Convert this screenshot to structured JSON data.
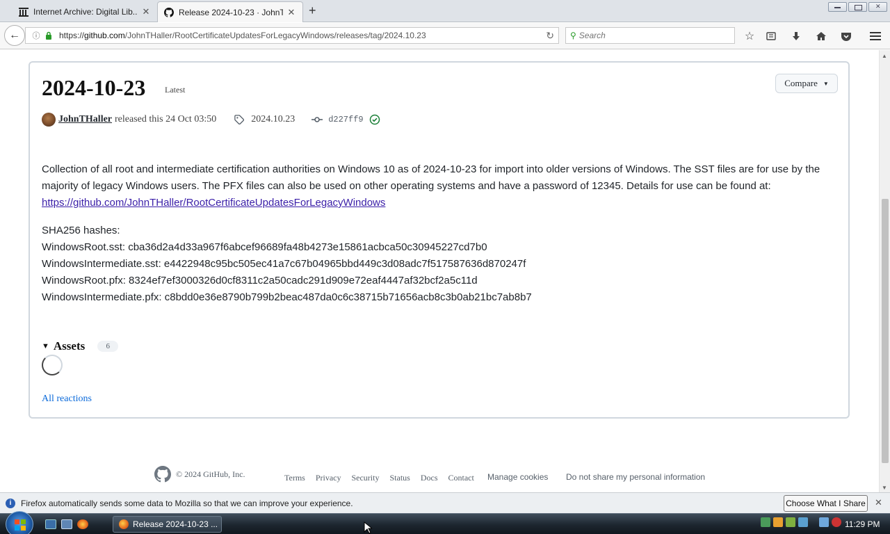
{
  "browser": {
    "tabs": [
      {
        "title": "Internet Archive: Digital Lib..."
      },
      {
        "title": "Release 2024-10-23 · JohnT..."
      }
    ],
    "url": {
      "prefix": "https://",
      "host": "github.com",
      "path": "/JohnTHaller/RootCertificateUpdatesForLegacyWindows/releases/tag/2024.10.23"
    },
    "search_placeholder": "Search"
  },
  "release": {
    "title": "2024-10-23",
    "badge": "Latest",
    "compare_label": "Compare",
    "author": "JohnTHaller",
    "released_text": "released this 24 Oct 03:50",
    "tag": "2024.10.23",
    "commit": "d227ff9",
    "description": "Collection of all root and intermediate certification authorities on Windows 10 as of 2024-10-23 for import into older versions of Windows. The SST files are for use by the majority of legacy Windows users. The PFX files can also be used on other operating systems and have a password of 12345. Details for use can be found at:",
    "link": "https://github.com/JohnTHaller/RootCertificateUpdatesForLegacyWindows",
    "hashes_heading": "SHA256 hashes:",
    "hashes": [
      "WindowsRoot.sst: cba36d2a4d33a967f6abcef96689fa48b4273e15861acbca50c30945227cd7b0",
      "WindowsIntermediate.sst: e4422948c95bc505ec41a7c67b04965bbd449c3d08adc7f517587636d870247f",
      "WindowsRoot.pfx: 8324ef7ef3000326d0cf8311c2a50cadc291d909e72eaf4447af32bcf2a5c11d",
      "WindowsIntermediate.pfx: c8bdd0e36e8790b799b2beac487da0c6c38715b71656acb8c3b0ab21bc7ab8b7"
    ],
    "assets_label": "Assets",
    "assets_count": "6",
    "reactions_label": "All reactions"
  },
  "footer": {
    "copyright": "© 2024 GitHub, Inc.",
    "links": [
      "Terms",
      "Privacy",
      "Security",
      "Status",
      "Docs",
      "Contact"
    ],
    "manage_cookies": "Manage cookies",
    "do_not_share": "Do not share my personal information"
  },
  "notification": {
    "text": "Firefox automatically sends some data to Mozilla so that we can improve your experience.",
    "button": "Choose What I Share"
  },
  "taskbar": {
    "task_label": "Release 2024-10-23 ...",
    "clock": "11:29 PM"
  },
  "colors": {
    "link_visited": "#3a1ea8",
    "link": "#0969da",
    "verified": "#1a7f37"
  }
}
